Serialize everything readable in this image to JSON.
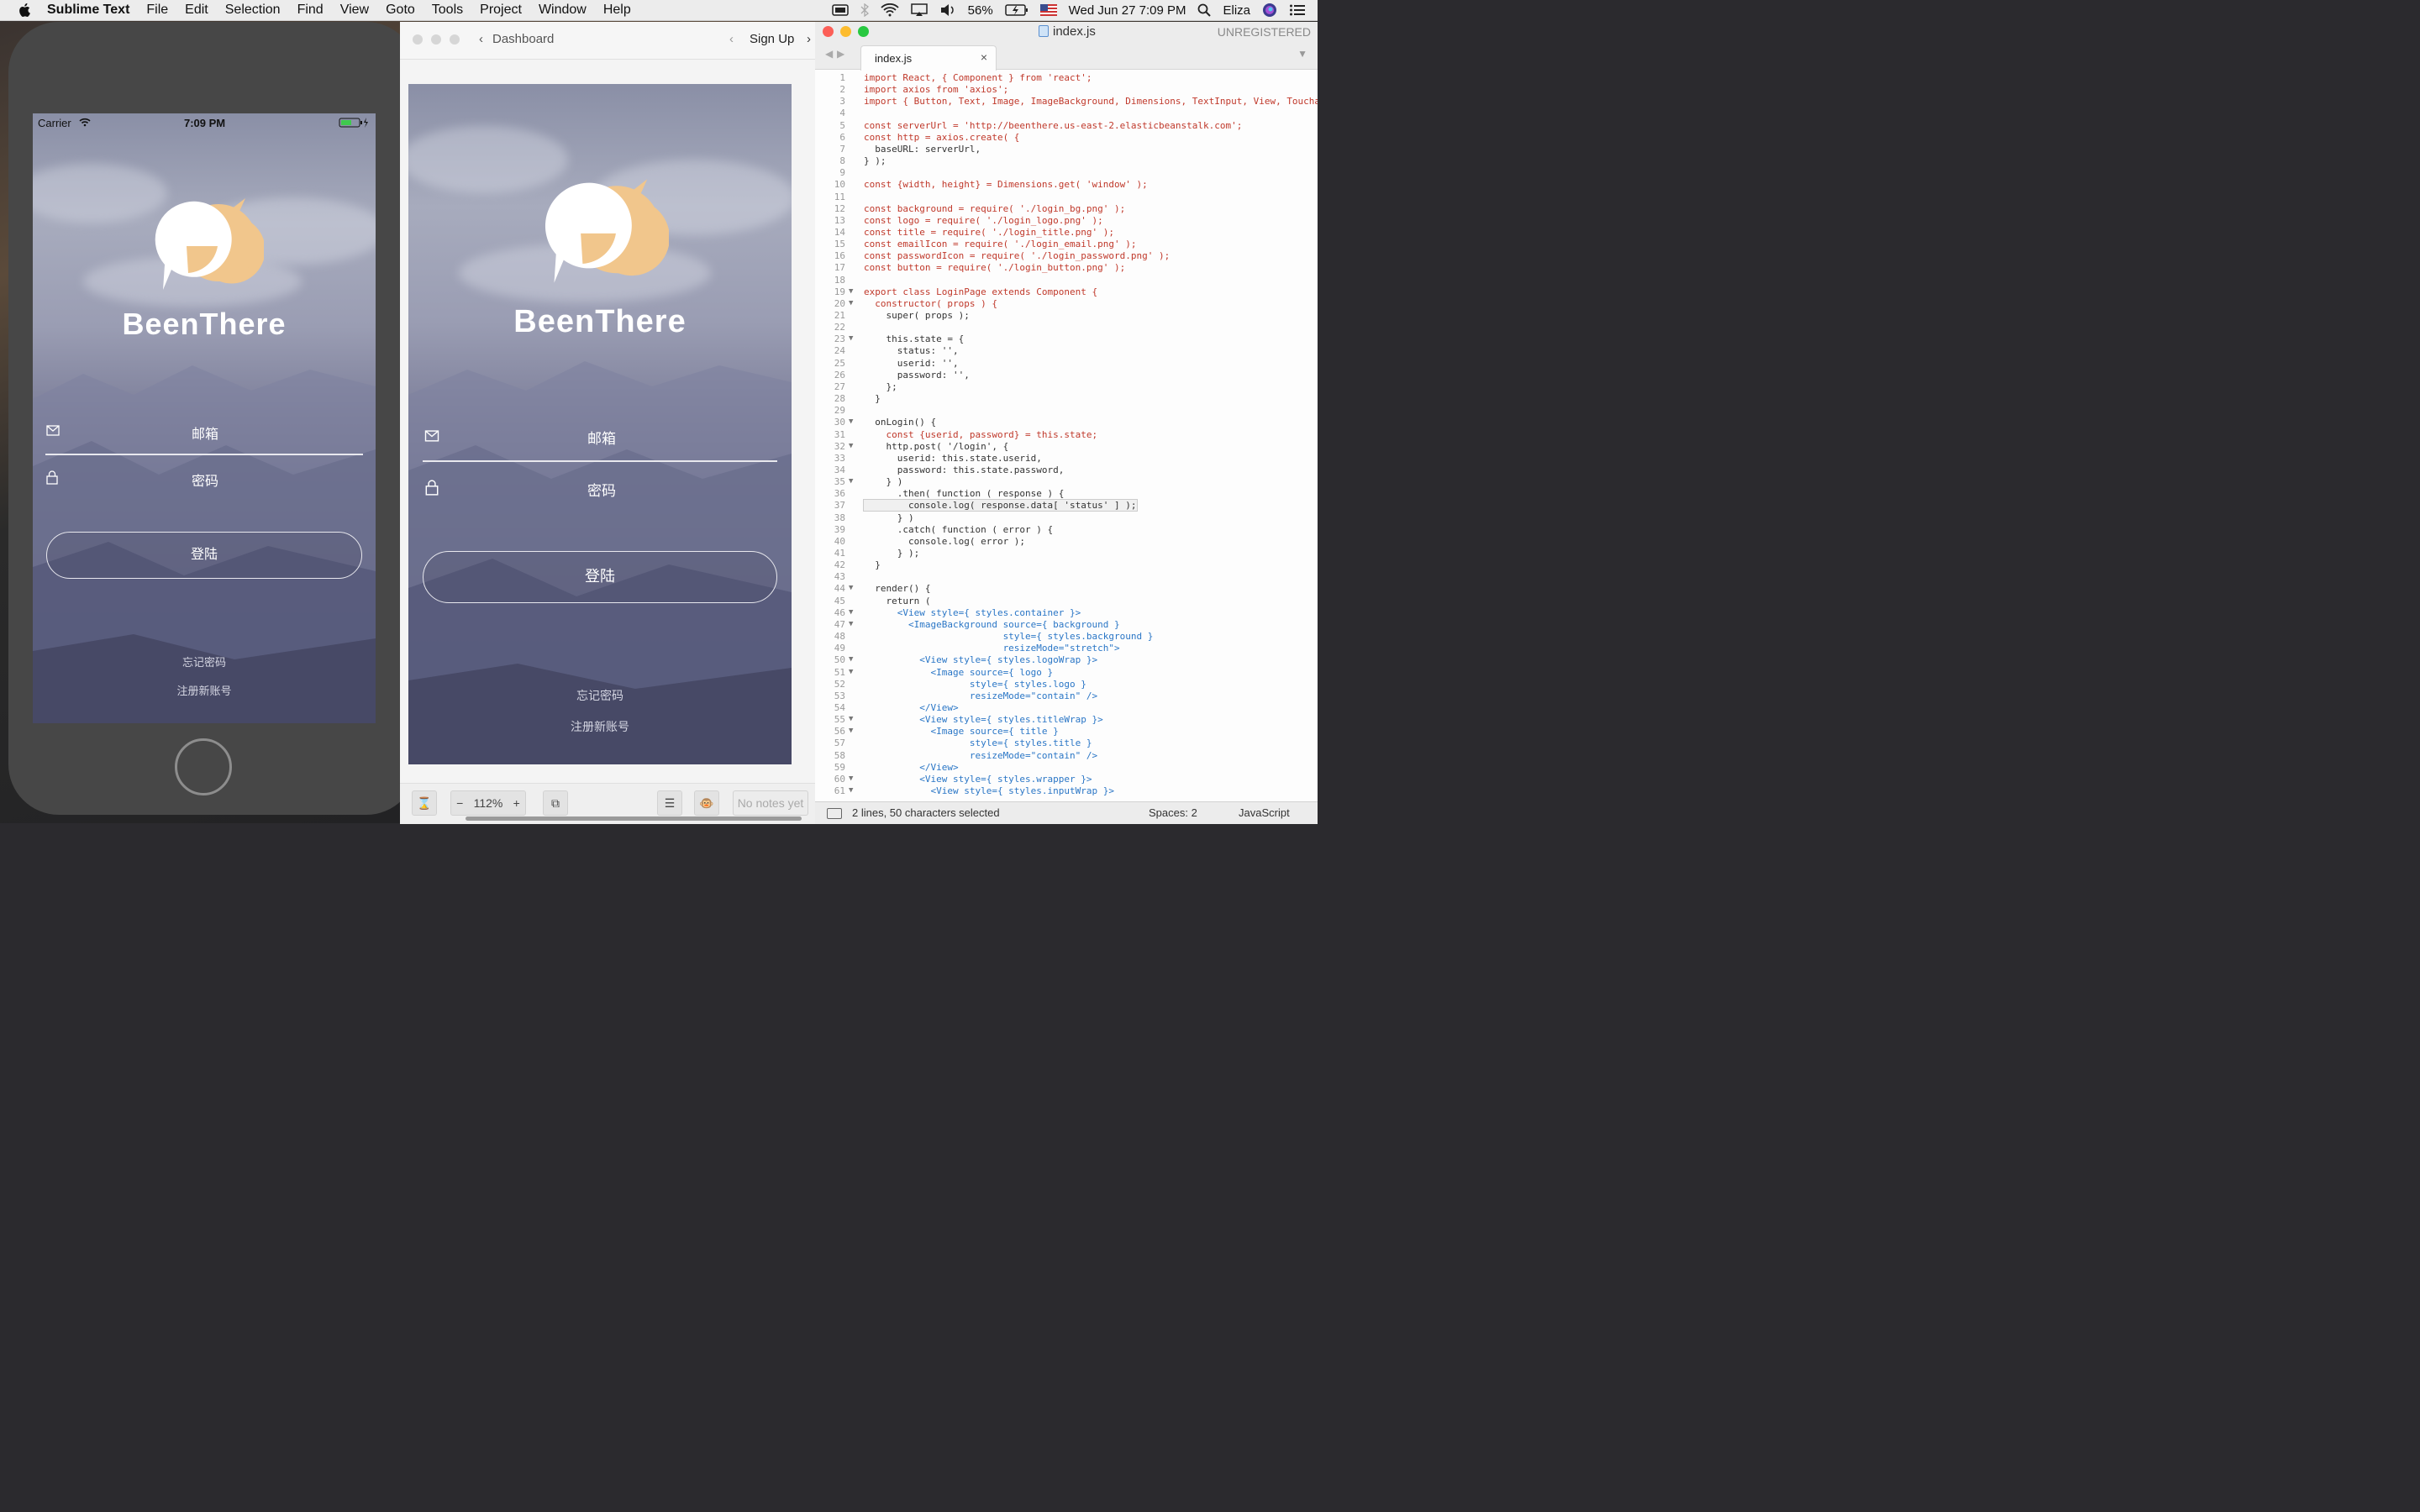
{
  "menubar": {
    "app_name": "Sublime Text",
    "menus": [
      "File",
      "Edit",
      "Selection",
      "Find",
      "View",
      "Goto",
      "Tools",
      "Project",
      "Window",
      "Help"
    ],
    "battery": "56%",
    "datetime": "Wed Jun 27  7:09 PM",
    "user": "Eliza"
  },
  "simulator": {
    "carrier": "Carrier",
    "time": "7:09 PM",
    "brand": "BeenThere",
    "email_placeholder": "邮箱",
    "password_placeholder": "密码",
    "login_label": "登陆",
    "forgot_label": "忘记密码",
    "register_label": "注册新账号"
  },
  "preview": {
    "back_label": "Dashboard",
    "forward_label": "Sign Up",
    "brand": "BeenThere",
    "email_placeholder": "邮箱",
    "password_placeholder": "密码",
    "login_label": "登陆",
    "forgot_label": "忘记密码",
    "register_label": "注册新账号",
    "zoom": "112%",
    "notes": "No notes yet"
  },
  "editor": {
    "title": "index.js",
    "license": "UNREGISTERED",
    "tab_label": "index.js",
    "status_selection": "2 lines, 50 characters selected",
    "status_spaces": "Spaces: 2",
    "status_syntax": "JavaScript",
    "code_lines": [
      "import React, { Component } from 'react';",
      "import axios from 'axios';",
      "import { Button, Text, Image, ImageBackground, Dimensions, TextInput, View, Touchab",
      "",
      "const serverUrl = 'http://beenthere.us-east-2.elasticbeanstalk.com';",
      "const http = axios.create( {",
      "  baseURL: serverUrl,",
      "} );",
      "",
      "const {width, height} = Dimensions.get( 'window' );",
      "",
      "const background = require( './login_bg.png' );",
      "const logo = require( './login_logo.png' );",
      "const title = require( './login_title.png' );",
      "const emailIcon = require( './login_email.png' );",
      "const passwordIcon = require( './login_password.png' );",
      "const button = require( './login_button.png' );",
      "",
      "export class LoginPage extends Component {",
      "  constructor( props ) {",
      "    super( props );",
      "",
      "    this.state = {",
      "      status: '',",
      "      userid: '',",
      "      password: '',",
      "    };",
      "  }",
      "",
      "  onLogin() {",
      "    const {userid, password} = this.state;",
      "    http.post( '/login', {",
      "      userid: this.state.userid,",
      "      password: this.state.password,",
      "    } )",
      "      .then( function ( response ) {",
      "        console.log( response.data[ 'status' ] );",
      "      } )",
      "      .catch( function ( error ) {",
      "        console.log( error );",
      "      } );",
      "  }",
      "",
      "  render() {",
      "    return (",
      "      <View style={ styles.container }>",
      "        <ImageBackground source={ background }",
      "                         style={ styles.background }",
      "                         resizeMode=\"stretch\">",
      "          <View style={ styles.logoWrap }>",
      "            <Image source={ logo }",
      "                   style={ styles.logo }",
      "                   resizeMode=\"contain\" />",
      "          </View>",
      "          <View style={ styles.titleWrap }>",
      "            <Image source={ title }",
      "                   style={ styles.title }",
      "                   resizeMode=\"contain\" />",
      "          </View>",
      "          <View style={ styles.wrapper }>",
      "            <View style={ styles.inputWrap }>"
    ]
  },
  "colors": {
    "accent_orange": "#f1c68c",
    "login_bg_bottom": "#444563",
    "close": "#fc5f57",
    "minimize": "#fdbc2e",
    "zoom": "#28c840"
  }
}
